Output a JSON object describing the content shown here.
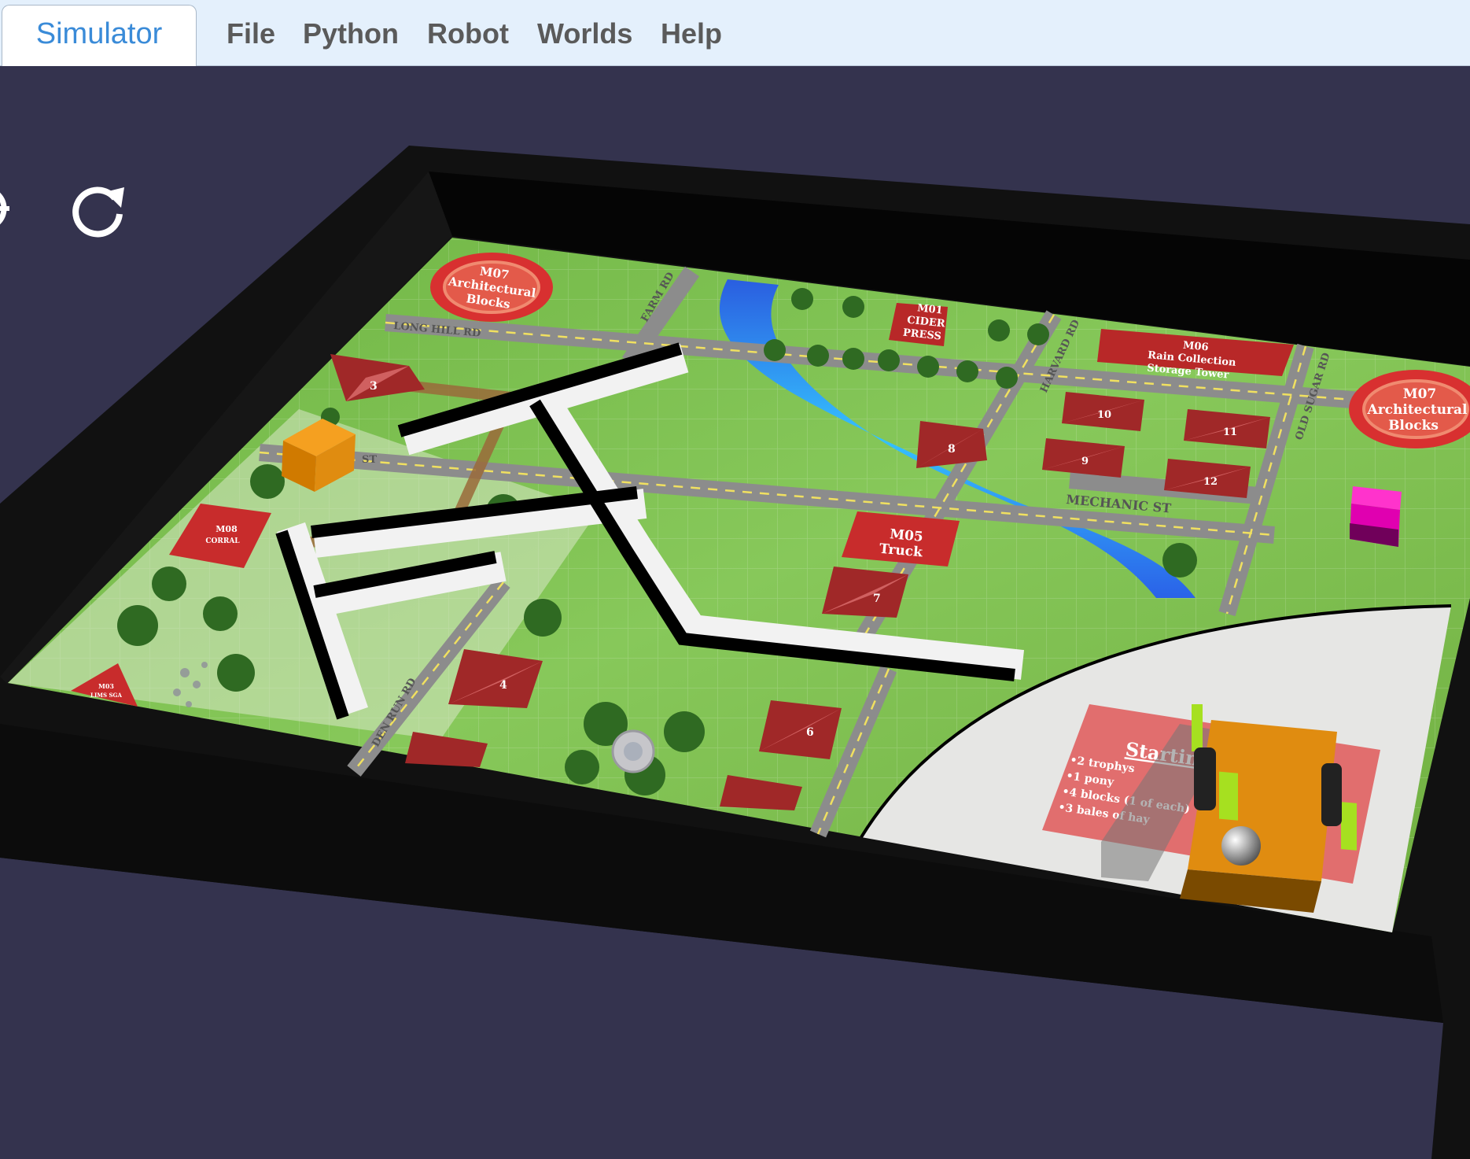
{
  "tabs": {
    "simulator": "Simulator"
  },
  "menu": {
    "file": "File",
    "python": "Python",
    "robot": "Robot",
    "worlds": "Worlds",
    "help": "Help"
  },
  "controls": {
    "left_icon": "partial-circle-icon",
    "reset_icon": "rotate-cw-icon"
  },
  "map": {
    "m07_top_left": [
      "M07",
      "Architectural",
      "Blocks"
    ],
    "m01": [
      "M01",
      "CIDER",
      "PRESS"
    ],
    "m06": [
      "M06",
      "Rain Collection",
      "Storage Tower"
    ],
    "m07_right": [
      "M07",
      "Architectural",
      "Blocks"
    ],
    "m05": [
      "M05",
      "Truck"
    ],
    "m08": [
      "M08",
      "CORRAL"
    ],
    "m03": [
      "M03",
      "LIMS SGA"
    ],
    "roads": {
      "long_hill": "LONG HILL RD",
      "farm": "FARM RD",
      "harvard": "HARVARD RD",
      "old_sugar": "OLD SUGAR RD",
      "mechanic": "MECHANIC ST",
      "golden_run": "DEN RUN RD",
      "st": "ST"
    },
    "house_numbers": [
      "3",
      "8",
      "10",
      "11",
      "9",
      "12",
      "7",
      "4",
      "6"
    ],
    "start_title": "Starting",
    "start_items": [
      "•2 trophys",
      "•1 pony",
      "•4 blocks (1 of each)",
      "•3 bales of hay"
    ]
  },
  "colors": {
    "accent": "#3a8bd8",
    "background": "#34334e",
    "board_frame": "#0f0f0f",
    "grass": "#7cc04a",
    "river": "#3aa0f0",
    "robot": "#e08a10"
  }
}
